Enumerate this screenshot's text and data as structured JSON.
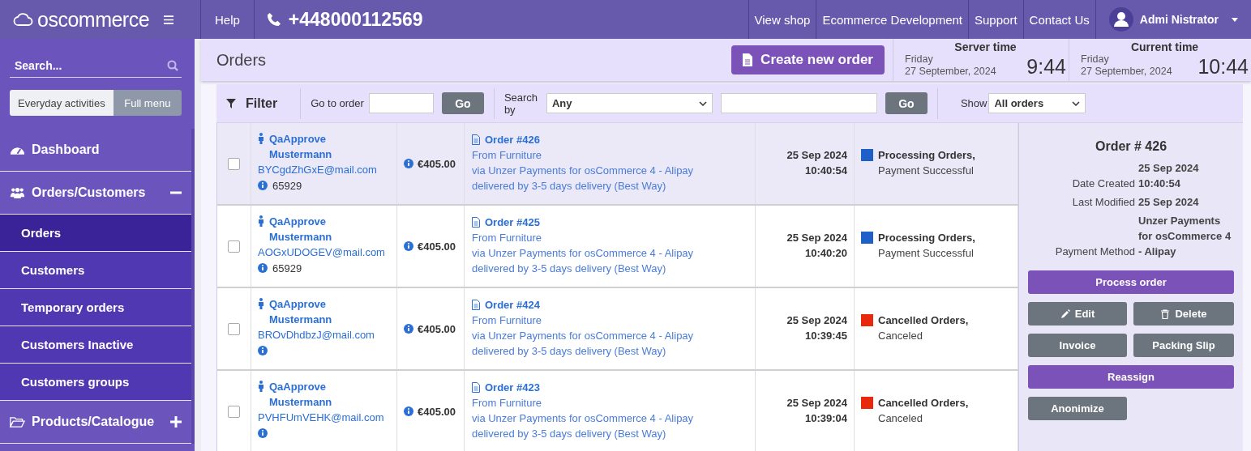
{
  "topbar": {
    "logo": "oscommerce",
    "help": "Help",
    "phone": "+448000112569",
    "links": [
      "View shop",
      "Ecommerce Development",
      "Support",
      "Contact Us"
    ],
    "user": "Admi Nistrator"
  },
  "sidebar": {
    "search_placeholder": "Search...",
    "tabs": [
      {
        "label": "Everyday activities",
        "selected": false
      },
      {
        "label": "Full menu",
        "selected": true
      }
    ],
    "items": [
      {
        "label": "Dashboard",
        "kind": "dashboard"
      },
      {
        "label": "Orders/Customers",
        "kind": "people",
        "expanded": true,
        "children": [
          {
            "label": "Orders",
            "selected": true
          },
          {
            "label": "Customers",
            "selected": false
          },
          {
            "label": "Temporary orders",
            "selected": false
          },
          {
            "label": "Customers Inactive",
            "selected": false
          },
          {
            "label": "Customers groups",
            "selected": false
          }
        ]
      },
      {
        "label": "Products/Catalogue",
        "kind": "folder",
        "expanded": false
      }
    ]
  },
  "page": {
    "title": "Orders",
    "create_button": "Create new order",
    "clocks": [
      {
        "title": "Server time",
        "day": "Friday",
        "date": "27 September, 2024",
        "time": "9:44"
      },
      {
        "title": "Current time",
        "day": "Friday",
        "date": "27 September, 2024",
        "time": "10:44"
      }
    ]
  },
  "filter": {
    "label": "Filter",
    "goto_label": "Go to order",
    "go": "Go",
    "search_label": "Search by",
    "search_value": "Any",
    "go2": "Go",
    "show_label": "Show",
    "show_value": "All orders"
  },
  "orders": [
    {
      "selected": true,
      "checked": false,
      "customer": "QaApprove Mustermann",
      "email": "BYCgdZhGxE@mail.com",
      "customer_id": "65929",
      "amount": "€405.00",
      "order": "Order #426",
      "from": "From Furniture",
      "payment": "via Unzer Payments for osCommerce 4 - Alipay",
      "delivery": "delivered by 3-5 days delivery (Best Way)",
      "date": "25 Sep 2024",
      "time": "10:40:54",
      "status": "Processing Orders,",
      "status_detail": "Payment Successful",
      "color": "#1f5fc8"
    },
    {
      "selected": false,
      "checked": false,
      "customer": "QaApprove Mustermann",
      "email": "AOGxUDOGEV@mail.com",
      "customer_id": "65929",
      "amount": "€405.00",
      "order": "Order #425",
      "from": "From Furniture",
      "payment": "via Unzer Payments for osCommerce 4 - Alipay",
      "delivery": "delivered by 3-5 days delivery (Best Way)",
      "date": "25 Sep 2024",
      "time": "10:40:20",
      "status": "Processing Orders,",
      "status_detail": "Payment Successful",
      "color": "#1f5fc8"
    },
    {
      "selected": false,
      "checked": false,
      "customer": "QaApprove Mustermann",
      "email": "BROvDhdbzJ@mail.com",
      "amount": "€405.00",
      "order": "Order #424",
      "from": "From Furniture",
      "payment": "via Unzer Payments for osCommerce 4 - Alipay",
      "delivery": "delivered by 3-5 days delivery (Best Way)",
      "date": "25 Sep 2024",
      "time": "10:39:45",
      "status": "Cancelled Orders,",
      "status_detail": "Canceled",
      "color": "#e8290d"
    },
    {
      "selected": false,
      "checked": false,
      "customer": "QaApprove Mustermann",
      "email": "PVHFUmVEHK@mail.com",
      "amount": "€405.00",
      "order": "Order #423",
      "from": "From Furniture",
      "payment": "via Unzer Payments for osCommerce 4 - Alipay",
      "delivery": "delivered by 3-5 days delivery (Best Way)",
      "date": "25 Sep 2024",
      "time": "10:39:04",
      "status": "Cancelled Orders,",
      "status_detail": "Canceled",
      "color": "#e8290d"
    }
  ],
  "details": {
    "title": "Order # 426",
    "fields": [
      {
        "label": "Date Created",
        "value": "25 Sep 2024 10:40:54"
      },
      {
        "label": "Last Modified",
        "value": "25 Sep 2024"
      },
      {
        "label": "Payment Method",
        "value": "Unzer Payments for osCommerce 4 - Alipay"
      }
    ],
    "buttons": [
      {
        "label": "Process order",
        "kind": "primary"
      },
      {
        "label": "Edit",
        "kind": "edit"
      },
      {
        "label": "Delete",
        "kind": "delete"
      },
      {
        "label": "Invoice",
        "kind": "plain"
      },
      {
        "label": "Packing Slip",
        "kind": "plain"
      },
      {
        "label": "Reassign",
        "kind": "primary"
      },
      {
        "label": "Anonimize",
        "kind": "plain"
      }
    ]
  }
}
